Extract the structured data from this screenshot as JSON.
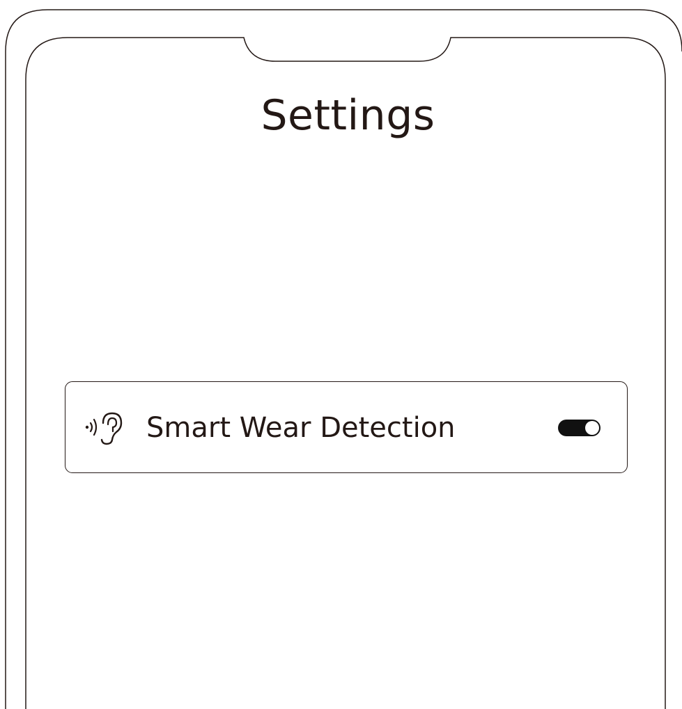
{
  "header": {
    "title": "Settings"
  },
  "settings": {
    "items": [
      {
        "label": "Smart Wear Detection",
        "icon": "ear-wave-icon",
        "toggle_state": "on"
      }
    ]
  },
  "colors": {
    "text": "#231815",
    "toggle_track": "#111111",
    "toggle_knob": "#ffffff",
    "background": "#ffffff"
  }
}
